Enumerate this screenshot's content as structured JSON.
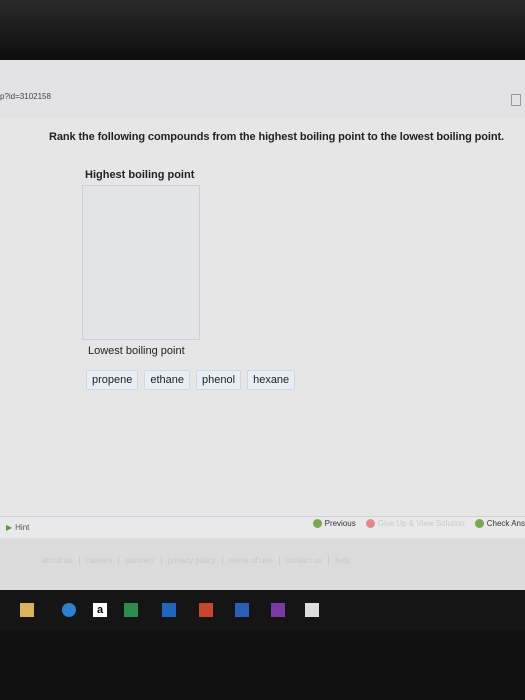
{
  "browser": {
    "url_fragment": "p?id=3102158"
  },
  "question": {
    "text": "Rank the following compounds from the highest boiling point to the lowest boiling point.",
    "highest_label": "Highest boiling point",
    "lowest_label": "Lowest boiling point",
    "items": [
      {
        "label": "propene"
      },
      {
        "label": "ethane"
      },
      {
        "label": "phenol"
      },
      {
        "label": "hexane"
      }
    ]
  },
  "nav": {
    "hint": "Hint",
    "previous": "Previous",
    "give_up": "Give Up & View Solution",
    "check": "Check Ans"
  },
  "footer": {
    "links": [
      "about us",
      "careers",
      "partners",
      "privacy policy",
      "terms of use",
      "contact us",
      "help"
    ]
  },
  "colors": {
    "chip_bg": "#e7eef6",
    "accent_green": "#7aa84d",
    "give_up_red": "#e08a8a"
  },
  "taskbar": {
    "icons": [
      "file-explorer-icon",
      "edge-icon",
      "amazon-icon",
      "excel-icon",
      "outlook-icon",
      "powerpoint-icon",
      "word-icon",
      "onenote-icon",
      "store-icon"
    ],
    "amazon_glyph": "a"
  }
}
